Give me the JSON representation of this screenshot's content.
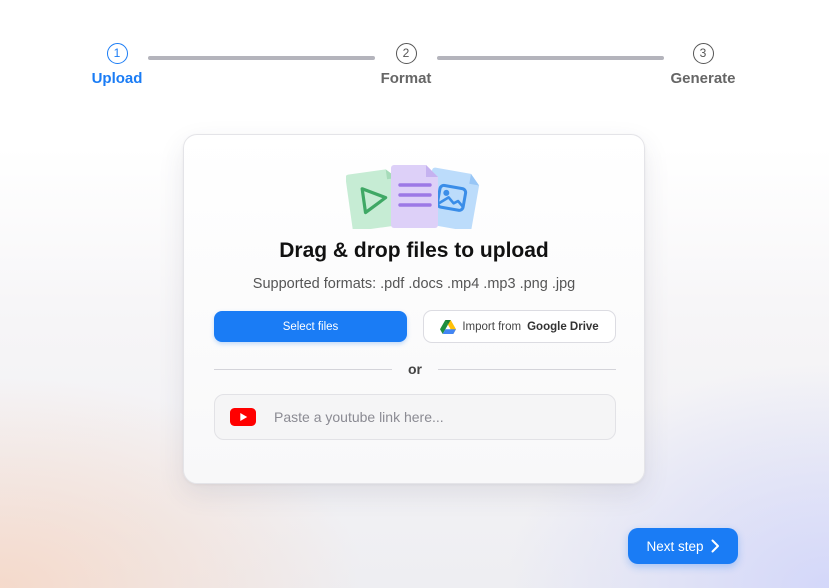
{
  "stepper": {
    "steps": [
      {
        "number": "1",
        "label": "Upload",
        "state": "active"
      },
      {
        "number": "2",
        "label": "Format",
        "state": "inactive"
      },
      {
        "number": "3",
        "label": "Generate",
        "state": "inactive"
      }
    ]
  },
  "upload_card": {
    "title": "Drag & drop files to upload",
    "subtitle": "Supported formats: .pdf .docs .mp4 .mp3 .png .jpg",
    "select_button_label": "Select files",
    "drive_button": {
      "prefix": "Import from ",
      "brand": "Google Drive"
    },
    "divider_text": "or",
    "youtube_field": {
      "value": "",
      "placeholder": "Paste a youtube link here..."
    }
  },
  "footer": {
    "next_button_label": "Next step"
  },
  "icons": {
    "illustration": "document-files-icon",
    "drive": "google-drive-icon",
    "youtube": "youtube-icon",
    "next": "chevron-right-icon"
  },
  "colors": {
    "accent": "#1a7cf5",
    "inactive_step": "#666666",
    "youtube_red": "#ff0000"
  }
}
